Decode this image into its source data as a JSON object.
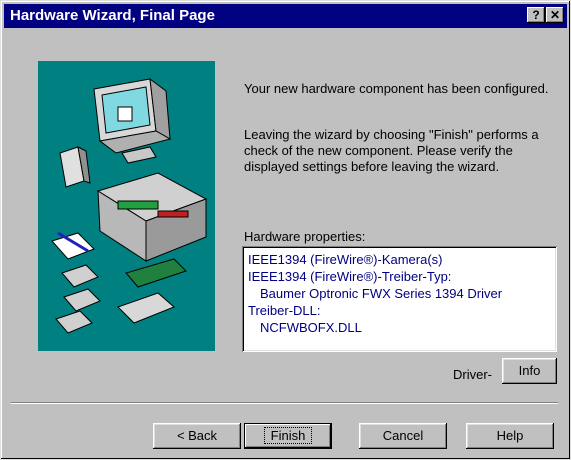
{
  "window": {
    "title": "Hardware Wizard, Final Page",
    "help_btn": "?",
    "close_btn": "✕"
  },
  "content": {
    "para1": "Your new hardware component has been configured.",
    "para2": "Leaving the wizard by choosing \"Finish\" performs a check of the new component. Please verify the displayed settings before leaving the wizard.",
    "hw_label": "Hardware properties:",
    "properties": [
      "IEEE1394 (FireWire®)-Kamera(s)",
      "IEEE1394 (FireWire®)-Treiber-Typ:",
      "Baumer Optronic FWX Series 1394 Driver",
      "Treiber-DLL:",
      "NCFWBOFX.DLL"
    ],
    "driver_label": "Driver-"
  },
  "buttons": {
    "info": "Info",
    "back": "< Back",
    "finish": "Finish",
    "cancel": "Cancel",
    "help": "Help"
  },
  "colors": {
    "illustration_bg": "#008080",
    "titlebar": "#000080"
  }
}
